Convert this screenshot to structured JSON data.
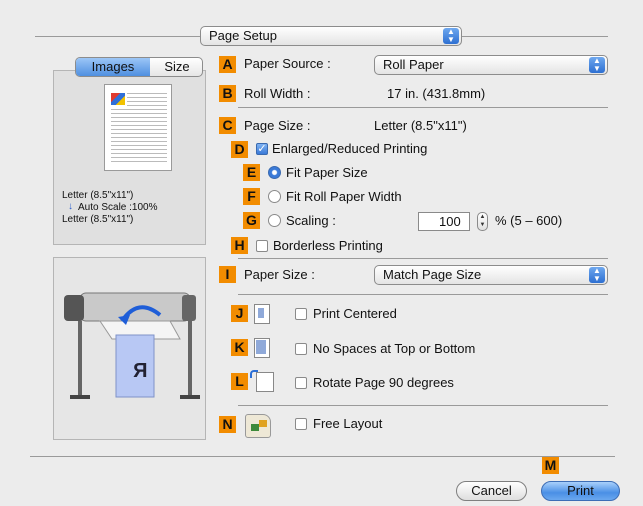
{
  "top_popup": {
    "label": "Page Setup"
  },
  "tabs": {
    "images": "Images",
    "size": "Size"
  },
  "preview": {
    "line1": "Letter (8.5\"x11\")",
    "arrow": "↓",
    "line2": "Auto Scale :100%",
    "line3": "Letter (8.5\"x11\")"
  },
  "badges": {
    "A": "A",
    "B": "B",
    "C": "C",
    "D": "D",
    "E": "E",
    "F": "F",
    "G": "G",
    "H": "H",
    "I": "I",
    "J": "J",
    "K": "K",
    "L": "L",
    "M": "M",
    "N": "N"
  },
  "paper_source": {
    "label": "Paper Source :",
    "value": "Roll Paper"
  },
  "roll_width": {
    "label": "Roll Width :",
    "value": "17 in. (431.8mm)"
  },
  "page_size": {
    "label": "Page Size :",
    "value": "Letter (8.5\"x11\")"
  },
  "enlarged": {
    "label": "Enlarged/Reduced Printing",
    "checked": true
  },
  "fit_paper": {
    "label": "Fit Paper Size",
    "selected": true
  },
  "fit_roll": {
    "label": "Fit Roll Paper Width",
    "selected": false
  },
  "scaling": {
    "label": "Scaling :",
    "value": "100",
    "range": "% (5 – 600)",
    "selected": false
  },
  "borderless": {
    "label": "Borderless Printing",
    "checked": false
  },
  "paper_size": {
    "label": "Paper Size :",
    "value": "Match Page Size"
  },
  "print_centered": {
    "label": "Print Centered",
    "checked": false
  },
  "no_spaces": {
    "label": "No Spaces at Top or Bottom",
    "checked": false
  },
  "rotate": {
    "label": "Rotate Page 90 degrees",
    "checked": false
  },
  "free_layout": {
    "label": "Free Layout",
    "checked": false
  },
  "buttons": {
    "cancel": "Cancel",
    "print": "Print"
  },
  "printer_sheet_letter": "R",
  "colors": {
    "badge": "#f28c00",
    "accent": "#3a7ad8",
    "panel": "#ececec"
  }
}
